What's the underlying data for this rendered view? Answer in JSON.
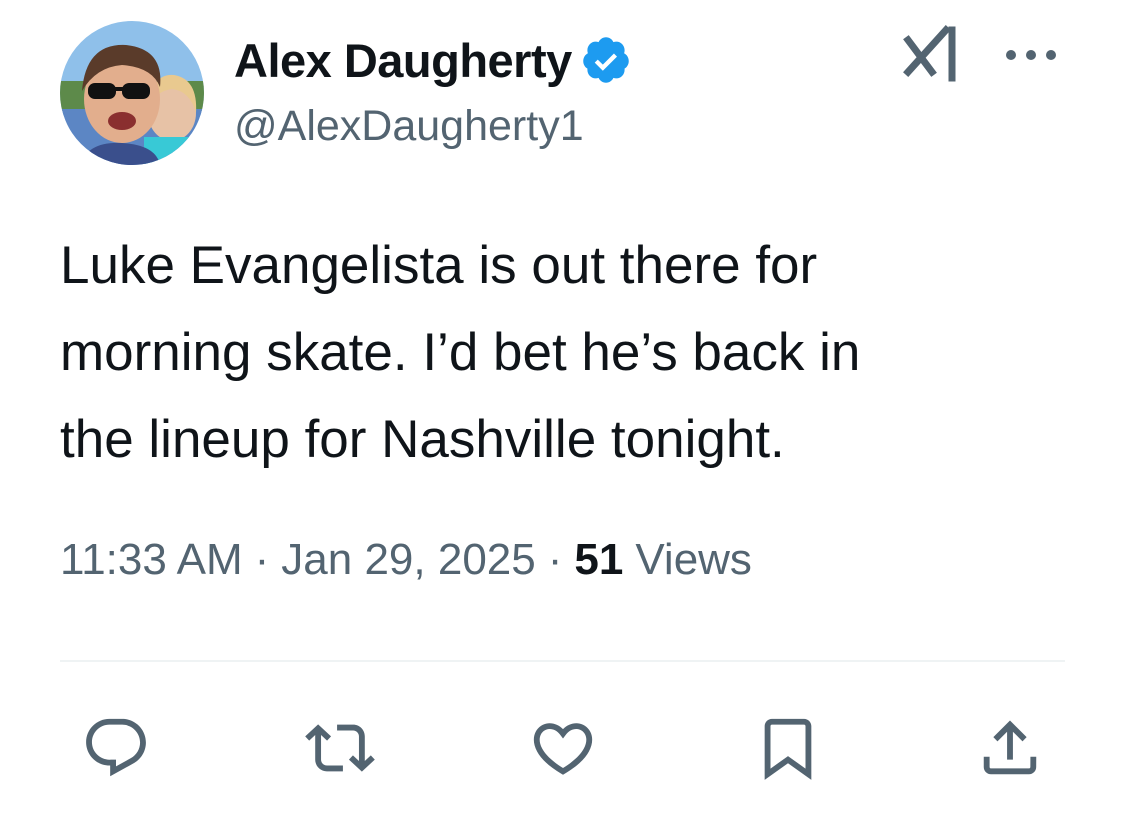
{
  "author": {
    "display_name": "Alex Daugherty",
    "handle": "@AlexDaugherty1",
    "verified": true,
    "verified_color": "#1d9bf0"
  },
  "tweet": {
    "text": "Luke Evangelista is out there for\nmorning skate. I’d bet he’s back in\nthe lineup for Nashville tonight.",
    "time": "11:33 AM",
    "separator": "·",
    "date": "Jan 29, 2025",
    "views_count": "51",
    "views_label": "Views"
  },
  "header_icons": [
    "grok-icon",
    "more-icon"
  ],
  "actions": [
    "reply-icon",
    "retweet-icon",
    "like-icon",
    "bookmark-icon",
    "share-icon"
  ],
  "colors": {
    "text_primary": "#0f1419",
    "text_secondary": "#536471",
    "icon": "#536471",
    "divider": "#eff3f4"
  }
}
